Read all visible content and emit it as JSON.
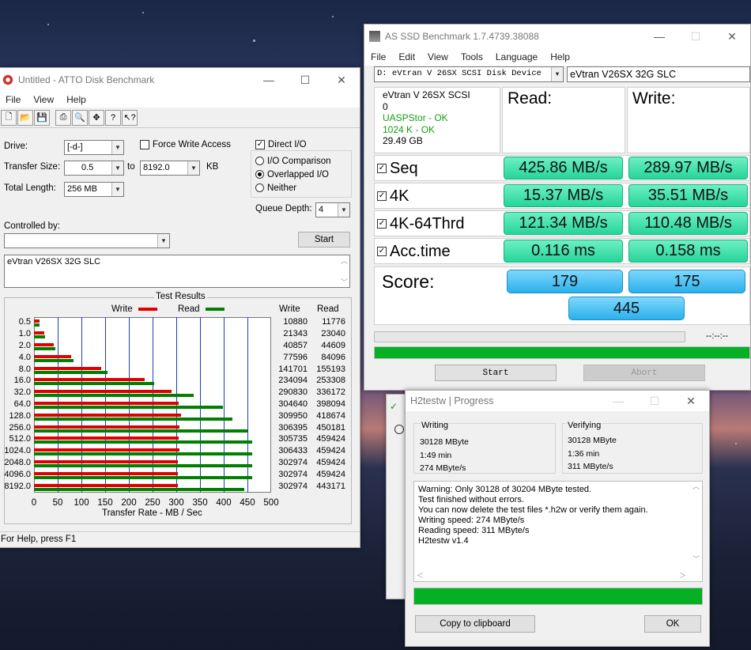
{
  "atto": {
    "title": "Untitled - ATTO Disk Benchmark",
    "menu": [
      "File",
      "View",
      "Help"
    ],
    "drive_label": "Drive:",
    "drive_value": "[-d-]",
    "force_write_label": "Force Write Access",
    "direct_io_label": "Direct I/O",
    "transfer_size_label": "Transfer Size:",
    "transfer_from": "0.5",
    "transfer_to_label": "to",
    "transfer_to": "8192.0",
    "transfer_unit": "KB",
    "total_length_label": "Total Length:",
    "total_length": "256 MB",
    "io_comparison": "I/O Comparison",
    "overlapped_io": "Overlapped I/O",
    "neither": "Neither",
    "queue_depth_label": "Queue Depth:",
    "queue_depth": "4",
    "controlled_by_label": "Controlled by:",
    "start_label": "Start",
    "description": "eVtran V26SX 32G SLC",
    "status_bar": "For Help, press F1"
  },
  "chart_data": {
    "type": "bar",
    "title": "Test Results",
    "legend": [
      "Write",
      "Read"
    ],
    "colors": {
      "write": "#e00000",
      "read": "#008000"
    },
    "xlabel": "Transfer Rate - MB / Sec",
    "xlim": [
      0,
      500
    ],
    "x_ticks": [
      "0",
      "50",
      "100",
      "150",
      "200",
      "250",
      "300",
      "350",
      "400",
      "450",
      "500"
    ],
    "col_write": "Write",
    "col_read": "Read",
    "categories": [
      "0.5",
      "1.0",
      "2.0",
      "4.0",
      "8.0",
      "16.0",
      "32.0",
      "64.0",
      "128.0",
      "256.0",
      "512.0",
      "1024.0",
      "2048.0",
      "4096.0",
      "8192.0"
    ],
    "series": [
      {
        "name": "Write",
        "values": [
          10880,
          21343,
          40857,
          77596,
          141701,
          234094,
          290830,
          304640,
          309950,
          306395,
          305735,
          306433,
          302974,
          302974,
          302974
        ]
      },
      {
        "name": "Read",
        "values": [
          11776,
          23040,
          44609,
          84096,
          155193,
          253308,
          336172,
          398094,
          418674,
          450181,
          459424,
          459424,
          459424,
          459424,
          443171
        ]
      }
    ]
  },
  "asssd": {
    "title": "AS SSD Benchmark 1.7.4739.38088",
    "menu": [
      "File",
      "Edit",
      "View",
      "Tools",
      "Language",
      "Help"
    ],
    "device_select": "D: eVtran V 26SX SCSI Disk Device",
    "device_name_field": "eVtran V26SX 32G SLC",
    "info": [
      "eVtran V 26SX SCSI",
      "0",
      "UASPStor - OK",
      "1024 K - OK",
      "29.49 GB"
    ],
    "read_header": "Read:",
    "write_header": "Write:",
    "rows": [
      {
        "label": "Seq",
        "read": "425.86 MB/s",
        "write": "289.97 MB/s"
      },
      {
        "label": "4K",
        "read": "15.37 MB/s",
        "write": "35.51 MB/s"
      },
      {
        "label": "4K-64Thrd",
        "read": "121.34 MB/s",
        "write": "110.48 MB/s"
      },
      {
        "label": "Acc.time",
        "read": "0.116 ms",
        "write": "0.158 ms"
      }
    ],
    "score_label": "Score:",
    "score_read": "179",
    "score_write": "175",
    "score_total": "445",
    "time_display": "--:--:--",
    "start_label": "Start",
    "abort_label": "Abort",
    "progress": 1.0
  },
  "h2testw": {
    "title": "H2testw | Progress",
    "writing_label": "Writing",
    "writing_size": "30128 MByte",
    "writing_time": "1:49 min",
    "writing_speed": "274 MByte/s",
    "verifying_label": "Verifying",
    "verifying_size": "30128 MByte",
    "verifying_time": "1:36 min",
    "verifying_speed": "311 MByte/s",
    "log": [
      "Warning: Only 30128 of 30204 MByte tested.",
      "Test finished without errors.",
      "You can now delete the test files *.h2w or verify them again.",
      "Writing speed: 274 MByte/s",
      "Reading speed: 311 MByte/s",
      "H2testw v1.4"
    ],
    "copy_label": "Copy to clipboard",
    "ok_label": "OK",
    "progress": 1.0
  }
}
